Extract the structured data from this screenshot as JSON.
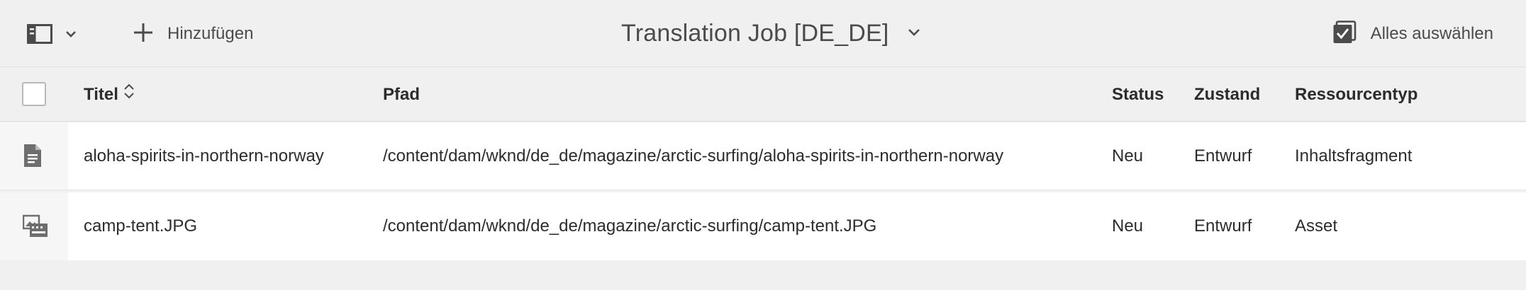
{
  "toolbar": {
    "add_label": "Hinzufügen",
    "title": "Translation Job [DE_DE]",
    "select_all_label": "Alles auswählen"
  },
  "table": {
    "columns": [
      "Titel",
      "Pfad",
      "Status",
      "Zustand",
      "Ressourcentyp"
    ],
    "rows": [
      {
        "icon": "document-icon",
        "title": "aloha-spirits-in-northern-norway",
        "path": "/content/dam/wknd/de_de/magazine/arctic-surfing/aloha-spirits-in-northern-norway",
        "status": "Neu",
        "zustand": "Entwurf",
        "typ": "Inhaltsfragment"
      },
      {
        "icon": "image-asset-icon",
        "title": "camp-tent.JPG",
        "path": "/content/dam/wknd/de_de/magazine/arctic-surfing/camp-tent.JPG",
        "status": "Neu",
        "zustand": "Entwurf",
        "typ": "Asset"
      }
    ]
  },
  "icons": {
    "rail": "rail-toggle-icon",
    "add": "plus-icon",
    "select_all": "select-all-checkbox-icon",
    "sort": "sort-icon",
    "chevron": "chevron-down-icon"
  },
  "colors": {
    "background": "#f0f0f0",
    "row_background": "#ffffff",
    "text": "#2c2c2c",
    "muted_text": "#4b4b4b"
  }
}
